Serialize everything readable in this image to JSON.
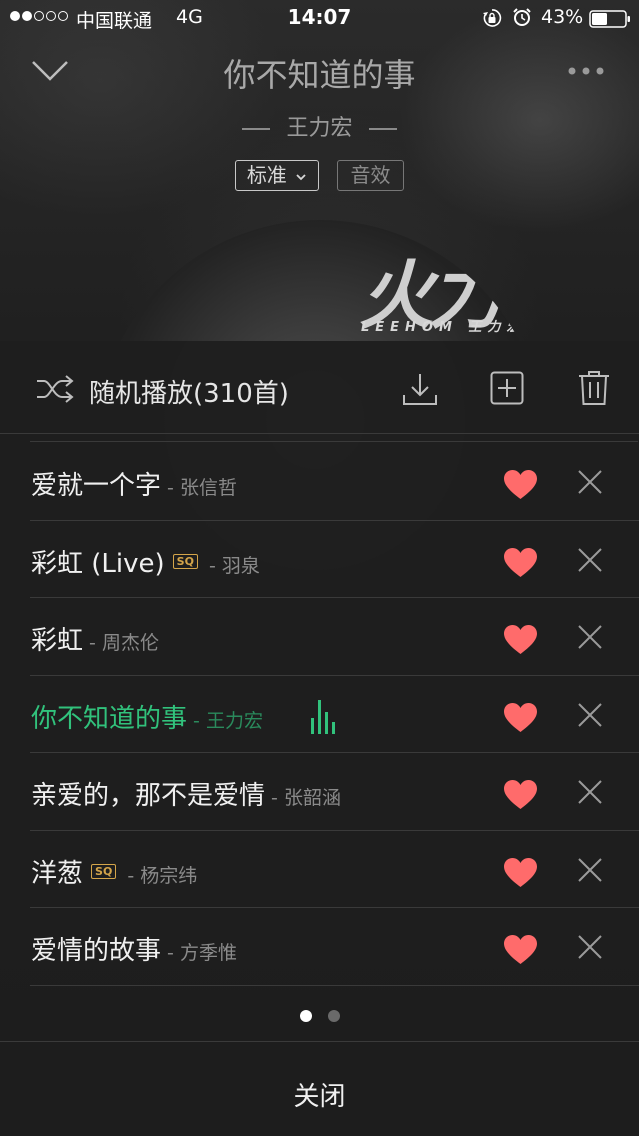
{
  "status_bar": {
    "carrier": "中国联通",
    "network": "4G",
    "time": "14:07",
    "battery": "43%",
    "signal_bars_filled": 2,
    "signal_bars_total": 5
  },
  "header": {
    "title": "你不知道的事",
    "artist": "王力宏",
    "quality_label": "标准",
    "effect_label": "音效"
  },
  "album": {
    "art_text": "火力",
    "art_subtext": "LEEHOM 王力宏"
  },
  "playlist": {
    "shuffle_label": "随机播放(310首)",
    "songs": [
      {
        "title": "爱就一个字",
        "sep": " - ",
        "artist": "张信哲",
        "sq": "",
        "favorite": true,
        "playing": false
      },
      {
        "title": "彩虹 (Live)",
        "sep": " - ",
        "artist": "羽泉",
        "sq": "SQ",
        "favorite": true,
        "playing": false
      },
      {
        "title": "彩虹",
        "sep": " - ",
        "artist": "周杰伦",
        "sq": "",
        "favorite": true,
        "playing": false
      },
      {
        "title": "你不知道的事",
        "sep": " - ",
        "artist": "王力宏",
        "sq": "",
        "favorite": true,
        "playing": true
      },
      {
        "title": "亲爱的，那不是爱情",
        "sep": " - ",
        "artist": "张韶涵",
        "sq": "",
        "favorite": true,
        "playing": false
      },
      {
        "title": "洋葱",
        "sep": " - ",
        "artist": "杨宗纬",
        "sq": "SQ",
        "favorite": true,
        "playing": false
      },
      {
        "title": "爱情的故事",
        "sep": " - ",
        "artist": "方季惟",
        "sq": "",
        "favorite": true,
        "playing": false
      }
    ],
    "page_count": 2,
    "current_page": 1
  },
  "footer": {
    "close_label": "关闭"
  },
  "colors": {
    "accent_green": "#31c27c",
    "heart_red": "#ff6b6b",
    "sq_gold": "#d4a54a"
  }
}
